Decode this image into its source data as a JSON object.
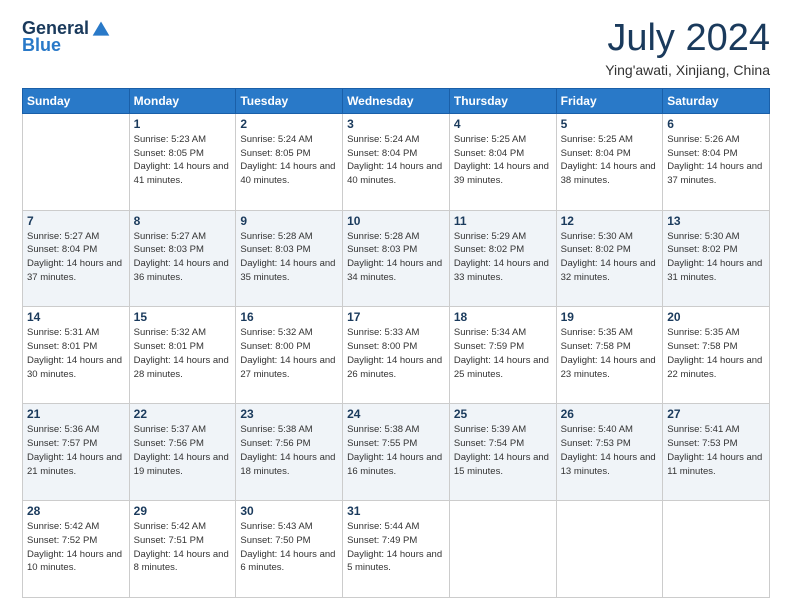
{
  "header": {
    "logo_general": "General",
    "logo_blue": "Blue",
    "month_title": "July 2024",
    "location": "Ying'awati, Xinjiang, China"
  },
  "days_of_week": [
    "Sunday",
    "Monday",
    "Tuesday",
    "Wednesday",
    "Thursday",
    "Friday",
    "Saturday"
  ],
  "weeks": [
    [
      {
        "num": "",
        "info": ""
      },
      {
        "num": "1",
        "info": "Sunrise: 5:23 AM\nSunset: 8:05 PM\nDaylight: 14 hours\nand 41 minutes."
      },
      {
        "num": "2",
        "info": "Sunrise: 5:24 AM\nSunset: 8:05 PM\nDaylight: 14 hours\nand 40 minutes."
      },
      {
        "num": "3",
        "info": "Sunrise: 5:24 AM\nSunset: 8:04 PM\nDaylight: 14 hours\nand 40 minutes."
      },
      {
        "num": "4",
        "info": "Sunrise: 5:25 AM\nSunset: 8:04 PM\nDaylight: 14 hours\nand 39 minutes."
      },
      {
        "num": "5",
        "info": "Sunrise: 5:25 AM\nSunset: 8:04 PM\nDaylight: 14 hours\nand 38 minutes."
      },
      {
        "num": "6",
        "info": "Sunrise: 5:26 AM\nSunset: 8:04 PM\nDaylight: 14 hours\nand 37 minutes."
      }
    ],
    [
      {
        "num": "7",
        "info": "Sunrise: 5:27 AM\nSunset: 8:04 PM\nDaylight: 14 hours\nand 37 minutes."
      },
      {
        "num": "8",
        "info": "Sunrise: 5:27 AM\nSunset: 8:03 PM\nDaylight: 14 hours\nand 36 minutes."
      },
      {
        "num": "9",
        "info": "Sunrise: 5:28 AM\nSunset: 8:03 PM\nDaylight: 14 hours\nand 35 minutes."
      },
      {
        "num": "10",
        "info": "Sunrise: 5:28 AM\nSunset: 8:03 PM\nDaylight: 14 hours\nand 34 minutes."
      },
      {
        "num": "11",
        "info": "Sunrise: 5:29 AM\nSunset: 8:02 PM\nDaylight: 14 hours\nand 33 minutes."
      },
      {
        "num": "12",
        "info": "Sunrise: 5:30 AM\nSunset: 8:02 PM\nDaylight: 14 hours\nand 32 minutes."
      },
      {
        "num": "13",
        "info": "Sunrise: 5:30 AM\nSunset: 8:02 PM\nDaylight: 14 hours\nand 31 minutes."
      }
    ],
    [
      {
        "num": "14",
        "info": "Sunrise: 5:31 AM\nSunset: 8:01 PM\nDaylight: 14 hours\nand 30 minutes."
      },
      {
        "num": "15",
        "info": "Sunrise: 5:32 AM\nSunset: 8:01 PM\nDaylight: 14 hours\nand 28 minutes."
      },
      {
        "num": "16",
        "info": "Sunrise: 5:32 AM\nSunset: 8:00 PM\nDaylight: 14 hours\nand 27 minutes."
      },
      {
        "num": "17",
        "info": "Sunrise: 5:33 AM\nSunset: 8:00 PM\nDaylight: 14 hours\nand 26 minutes."
      },
      {
        "num": "18",
        "info": "Sunrise: 5:34 AM\nSunset: 7:59 PM\nDaylight: 14 hours\nand 25 minutes."
      },
      {
        "num": "19",
        "info": "Sunrise: 5:35 AM\nSunset: 7:58 PM\nDaylight: 14 hours\nand 23 minutes."
      },
      {
        "num": "20",
        "info": "Sunrise: 5:35 AM\nSunset: 7:58 PM\nDaylight: 14 hours\nand 22 minutes."
      }
    ],
    [
      {
        "num": "21",
        "info": "Sunrise: 5:36 AM\nSunset: 7:57 PM\nDaylight: 14 hours\nand 21 minutes."
      },
      {
        "num": "22",
        "info": "Sunrise: 5:37 AM\nSunset: 7:56 PM\nDaylight: 14 hours\nand 19 minutes."
      },
      {
        "num": "23",
        "info": "Sunrise: 5:38 AM\nSunset: 7:56 PM\nDaylight: 14 hours\nand 18 minutes."
      },
      {
        "num": "24",
        "info": "Sunrise: 5:38 AM\nSunset: 7:55 PM\nDaylight: 14 hours\nand 16 minutes."
      },
      {
        "num": "25",
        "info": "Sunrise: 5:39 AM\nSunset: 7:54 PM\nDaylight: 14 hours\nand 15 minutes."
      },
      {
        "num": "26",
        "info": "Sunrise: 5:40 AM\nSunset: 7:53 PM\nDaylight: 14 hours\nand 13 minutes."
      },
      {
        "num": "27",
        "info": "Sunrise: 5:41 AM\nSunset: 7:53 PM\nDaylight: 14 hours\nand 11 minutes."
      }
    ],
    [
      {
        "num": "28",
        "info": "Sunrise: 5:42 AM\nSunset: 7:52 PM\nDaylight: 14 hours\nand 10 minutes."
      },
      {
        "num": "29",
        "info": "Sunrise: 5:42 AM\nSunset: 7:51 PM\nDaylight: 14 hours\nand 8 minutes."
      },
      {
        "num": "30",
        "info": "Sunrise: 5:43 AM\nSunset: 7:50 PM\nDaylight: 14 hours\nand 6 minutes."
      },
      {
        "num": "31",
        "info": "Sunrise: 5:44 AM\nSunset: 7:49 PM\nDaylight: 14 hours\nand 5 minutes."
      },
      {
        "num": "",
        "info": ""
      },
      {
        "num": "",
        "info": ""
      },
      {
        "num": "",
        "info": ""
      }
    ]
  ]
}
